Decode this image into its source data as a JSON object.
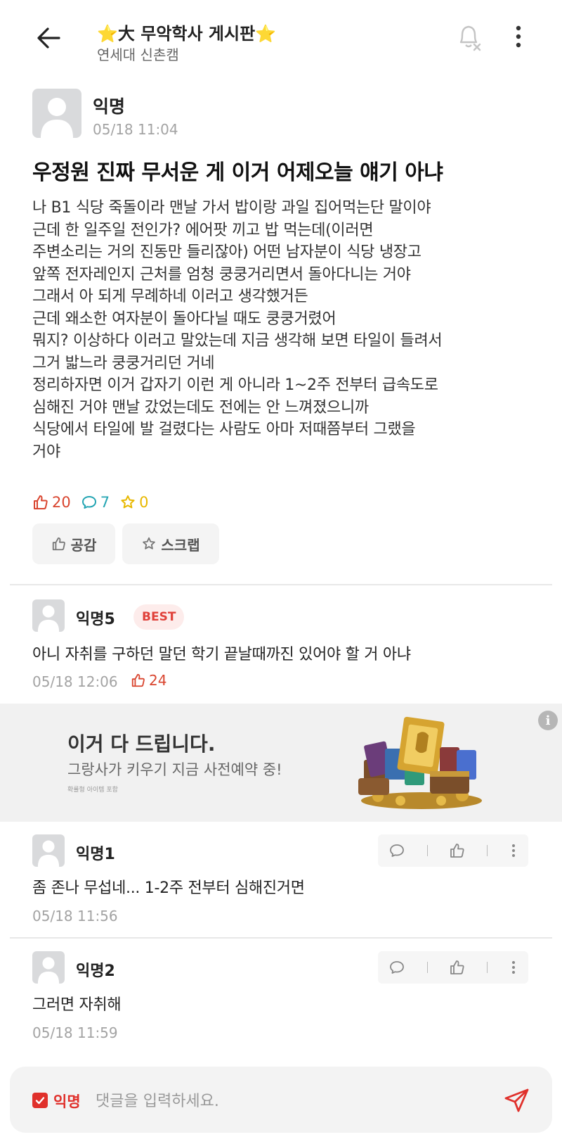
{
  "header": {
    "title": "⭐大 무악학사 게시판⭐",
    "subtitle": "연세대 신촌캠"
  },
  "post": {
    "author": "익명",
    "time": "05/18 11:04",
    "title": "우정원 진짜 무서운 게 이거 어제오늘 얘기 아냐",
    "body_lines": [
      "나 B1 식당 죽돌이라 맨날 가서 밥이랑 과일 집어먹는단 말이야",
      "근데 한 일주일 전인가? 에어팟 끼고 밥 먹는데(이러면",
      "주변소리는 거의 진동만 들리잖아) 어떤 남자분이 식당 냉장고",
      "앞쪽 전자레인지 근처를 엄청 쿵쿵거리면서 돌아다니는 거야",
      "그래서 아 되게 무례하네 이러고 생각했거든",
      "근데 왜소한 여자분이 돌아다닐 때도 쿵쿵거렸어",
      "뭐지? 이상하다 이러고 말았는데 지금 생각해 보면 타일이 들려서",
      "그거 밟느라 쿵쿵거리던 거네",
      "정리하자면 이거 갑자기 이런 게 아니라 1~2주 전부터 급속도로",
      "심해진 거야 맨날 갔었는데도 전에는 안 느껴졌으니까",
      "식당에서 타일에 발 걸렸다는 사람도 아마 저때쯤부터 그랬을",
      "거야"
    ],
    "likes": "20",
    "comments": "7",
    "scraps": "0",
    "like_button": "공감",
    "scrap_button": "스크랩"
  },
  "best_comment": {
    "author": "익명5",
    "badge": "BEST",
    "text": "아니 자취를 구하던 말던 학기 끝날때까진 있어야 할 거 아냐",
    "time": "05/18 12:06",
    "likes": "24"
  },
  "ad": {
    "info": "i",
    "title": "이거 다 드립니다.",
    "subtitle": "그랑사가 키우기 지금 사전예약 중!",
    "note": "확률형 아이템 포함"
  },
  "comments": [
    {
      "author": "익명1",
      "text": "좀 존나 무섭네... 1-2주 전부터 심해진거면",
      "time": "05/18 11:56"
    },
    {
      "author": "익명2",
      "text": "그러면 자취해",
      "time": "05/18 11:59"
    }
  ],
  "input_bar": {
    "anon_label": "익명",
    "placeholder": "댓글을 입력하세요."
  },
  "colors": {
    "accent_red": "#e0302b",
    "like_red": "#d9452f",
    "comment_teal": "#24a5b3",
    "scrap_yellow": "#e8b800"
  }
}
